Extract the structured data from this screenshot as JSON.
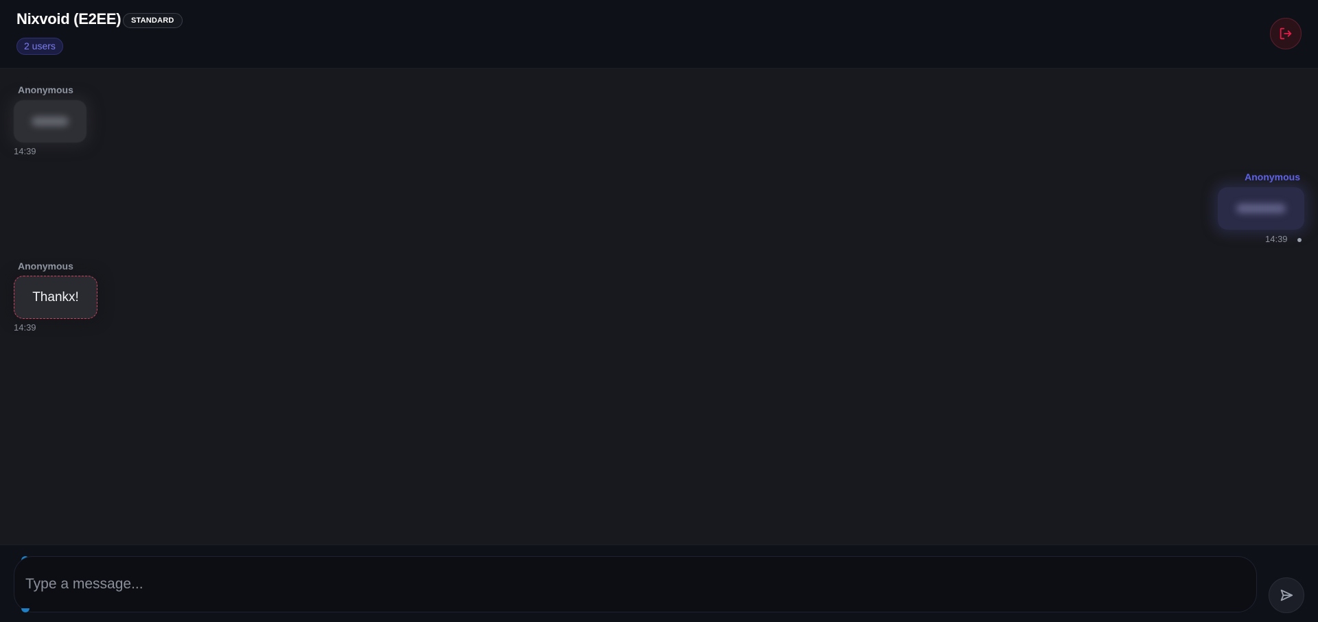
{
  "header": {
    "title": "Nixvoid (E2EE)",
    "mode_badge": "STANDARD",
    "users_count": "2 users",
    "leave_icon": "logout-icon"
  },
  "messages": [
    {
      "sender": "Anonymous",
      "side": "left",
      "text_hidden": true,
      "time": "14:39"
    },
    {
      "sender": "Anonymous",
      "side": "right",
      "text_hidden": true,
      "time": "14:39",
      "status": "sent-dot"
    },
    {
      "sender": "Anonymous",
      "side": "left",
      "text": "Thankx!",
      "time": "14:39"
    }
  ],
  "composer": {
    "placeholder": "Type a message...",
    "value": "",
    "send_icon": "send-icon"
  },
  "colors": {
    "accent": "#6366f1",
    "danger": "#e11d48",
    "background": "#18191e",
    "header": "#0f1118"
  }
}
